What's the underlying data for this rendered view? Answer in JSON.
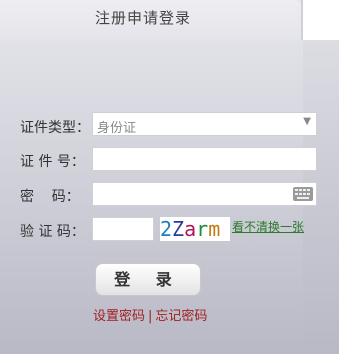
{
  "tab": {
    "title": "注册申请登录"
  },
  "form": {
    "id_type_label": "证件类型：",
    "id_type_value": "身份证",
    "id_number_label": "证 件 号：",
    "password_label": "密    码：",
    "captcha_label": "验 证 码：",
    "captcha_text": [
      "2",
      "Z",
      "a",
      "r",
      "m"
    ],
    "captcha_colors": [
      "#1b7fbf",
      "#2a3a9a",
      "#b0155a",
      "#1f8a3a",
      "#c27a0e"
    ],
    "refresh_link": "看不清换一张"
  },
  "login_button": {
    "label": "登 录"
  },
  "footer_links": {
    "set_password": "设置密码",
    "separator": "|",
    "forgot_password": "忘记密码"
  },
  "colors": {
    "link_red": "#a02020",
    "link_green": "#2a7a2a"
  }
}
